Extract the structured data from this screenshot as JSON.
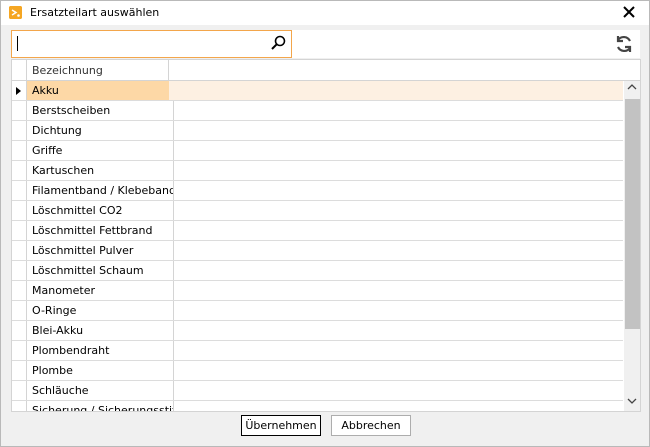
{
  "window": {
    "title": "Ersatzteilart auswählen",
    "close_glyph": "✕"
  },
  "search": {
    "value": "",
    "icon": "search-icon"
  },
  "toolbar": {
    "refresh_icon": "refresh-icon"
  },
  "grid": {
    "column_header": "Bezeichnung",
    "selected_index": 0,
    "rows": [
      "Akku",
      "Berstscheiben",
      "Dichtung",
      "Griffe",
      "Kartuschen",
      "Filamentband / Klebeband",
      "Löschmittel CO2",
      "Löschmittel Fettbrand",
      "Löschmittel Pulver",
      "Löschmittel Schaum",
      "Manometer",
      "O-Ringe",
      "Blei-Akku",
      "Plombendraht",
      "Plombe",
      "Schläuche",
      "Sicherung / Sicherungsstift"
    ]
  },
  "buttons": {
    "ok": "Übernehmen",
    "cancel": "Abbrechen"
  },
  "colors": {
    "accent": "#f3a64b",
    "selected_cell": "#fdd8a6",
    "selected_row": "#fdf0e2"
  }
}
